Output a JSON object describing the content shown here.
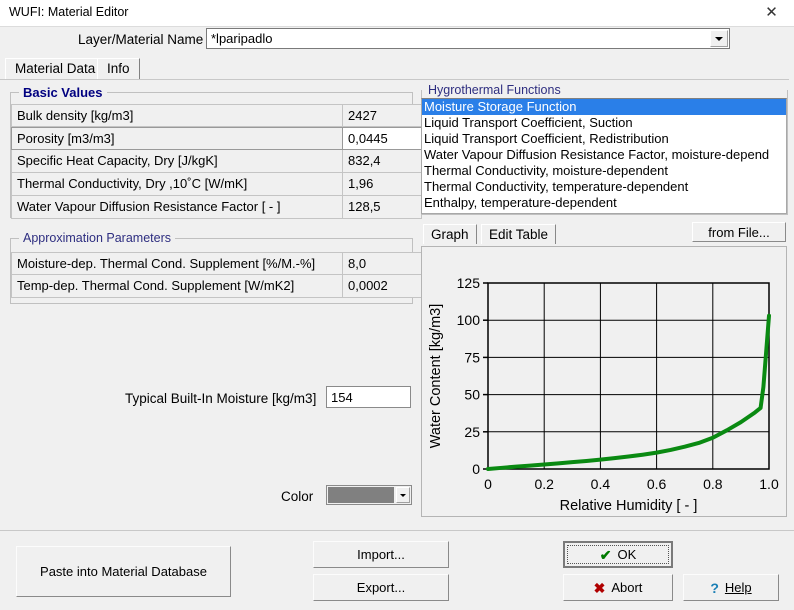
{
  "window": {
    "title": "WUFI: Material Editor",
    "close_icon": "close-icon"
  },
  "name_row": {
    "label": "Layer/Material Name",
    "value": "*lparipadlo",
    "dropdown_icon": "chevron-down-icon"
  },
  "tabs": [
    {
      "label": "Material Data",
      "selected": true
    },
    {
      "label": "Info",
      "selected": false
    }
  ],
  "basic_values": {
    "legend": "Basic Values",
    "rows": [
      {
        "label": "Bulk density [kg/m3]",
        "value": "2427",
        "active": false
      },
      {
        "label": "Porosity [m3/m3]",
        "value": "0,0445",
        "active": true
      },
      {
        "label": "Specific Heat Capacity, Dry [J/kgK]",
        "value": "832,4",
        "active": false
      },
      {
        "label": "Thermal Conductivity, Dry ,10˚C [W/mK]",
        "value": "1,96",
        "active": false
      },
      {
        "label": "Water Vapour Diffusion Resistance Factor [ - ]",
        "value": "128,5",
        "active": false
      }
    ]
  },
  "approximation_parameters": {
    "legend": "Approximation Parameters",
    "rows": [
      {
        "label": "Moisture-dep. Thermal Cond. Supplement [%/M.-%]",
        "value": "8,0"
      },
      {
        "label": "Temp-dep. Thermal Cond. Supplement [W/mK2]",
        "value": "0,0002"
      }
    ]
  },
  "built_in_moisture": {
    "label": "Typical Built-In Moisture [kg/m3]",
    "value": "154"
  },
  "color": {
    "label": "Color",
    "swatch_hex": "#808080",
    "dropdown_icon": "chevron-down-icon"
  },
  "hygrothermal": {
    "legend": "Hygrothermal Functions",
    "items": [
      {
        "label": "Moisture Storage Function",
        "selected": true
      },
      {
        "label": "Liquid Transport Coefficient, Suction",
        "selected": false
      },
      {
        "label": "Liquid Transport Coefficient, Redistribution",
        "selected": false
      },
      {
        "label": "Water Vapour Diffusion Resistance Factor, moisture-depend",
        "selected": false
      },
      {
        "label": "Thermal Conductivity, moisture-dependent",
        "selected": false
      },
      {
        "label": "Thermal Conductivity, temperature-dependent",
        "selected": false
      },
      {
        "label": "Enthalpy, temperature-dependent",
        "selected": false
      }
    ],
    "selection_hex": "#2a7fe8"
  },
  "graph_panel": {
    "tabs": [
      {
        "label": "Graph",
        "selected": true
      },
      {
        "label": "Edit Table",
        "selected": false
      }
    ],
    "from_file_button": "from File..."
  },
  "buttons": {
    "paste": "Paste into Material Database",
    "import": "Import...",
    "export": "Export...",
    "ok": "OK",
    "ok_icon": "check-icon",
    "abort": "Abort",
    "abort_icon": "cross-icon",
    "help": "Help",
    "help_icon": "question-icon"
  },
  "chart_data": {
    "type": "line",
    "title": "",
    "xlabel": "Relative Humidity [ - ]",
    "ylabel": "Water Content [kg/m3]",
    "xlim": [
      0,
      1.0
    ],
    "ylim": [
      0,
      125
    ],
    "xticks": [
      "0",
      "0.2",
      "0.4",
      "0.6",
      "0.8",
      "1.0"
    ],
    "xtick_values": [
      0,
      0.2,
      0.4,
      0.6,
      0.8,
      1.0
    ],
    "yticks": [
      "0",
      "25",
      "50",
      "75",
      "100",
      "125"
    ],
    "ytick_values": [
      0,
      25,
      50,
      75,
      100,
      125
    ],
    "grid": true,
    "legend": "none",
    "line_color": "#0a8a12",
    "line_width": 4,
    "series": [
      {
        "name": "Moisture Storage Function",
        "x": [
          0.0,
          0.05,
          0.1,
          0.15,
          0.2,
          0.25,
          0.3,
          0.35,
          0.4,
          0.45,
          0.5,
          0.55,
          0.6,
          0.65,
          0.7,
          0.75,
          0.8,
          0.85,
          0.9,
          0.95,
          0.97,
          0.98,
          1.0
        ],
        "y": [
          0.0,
          0.8,
          1.6,
          2.3,
          3.0,
          3.8,
          4.6,
          5.4,
          6.3,
          7.3,
          8.4,
          9.6,
          11.0,
          12.8,
          15.0,
          17.5,
          21.0,
          26.0,
          31.5,
          38.0,
          41.0,
          55.0,
          103.0
        ]
      }
    ]
  }
}
